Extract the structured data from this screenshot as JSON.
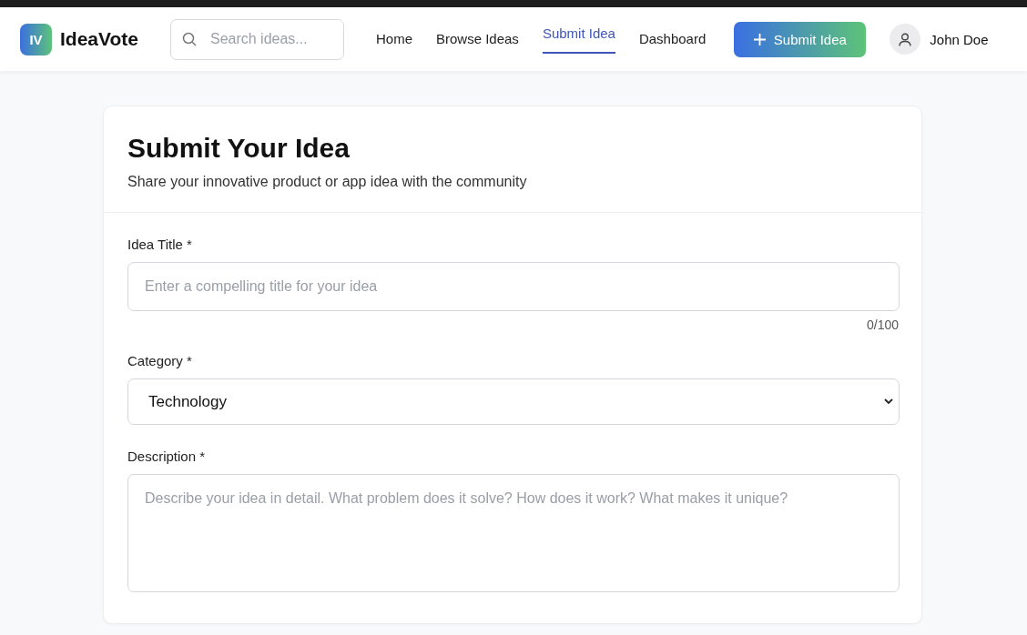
{
  "header": {
    "logo_mark": "IV",
    "brand": "IdeaVote",
    "search": {
      "placeholder": "Search ideas..."
    },
    "nav": [
      {
        "label": "Home",
        "selected": false
      },
      {
        "label": "Browse Ideas",
        "selected": false
      },
      {
        "label": "Submit Idea",
        "selected": true
      },
      {
        "label": "Dashboard",
        "selected": false
      }
    ],
    "action_button": "Submit Idea",
    "user": "John Doe"
  },
  "form": {
    "title": "Submit Your Idea",
    "subtitle": "Share your innovative product or app idea with the community",
    "fields": [
      {
        "kind": "text",
        "label": "Idea Title *",
        "placeholder": "Enter a compelling title for your idea",
        "counter": "0/100"
      },
      {
        "kind": "select",
        "label": "Category *",
        "value": "Technology"
      },
      {
        "kind": "textarea",
        "label": "Description *",
        "placeholder": "Describe your idea in detail. What problem does it solve? How does it work? What makes it unique?"
      }
    ]
  }
}
